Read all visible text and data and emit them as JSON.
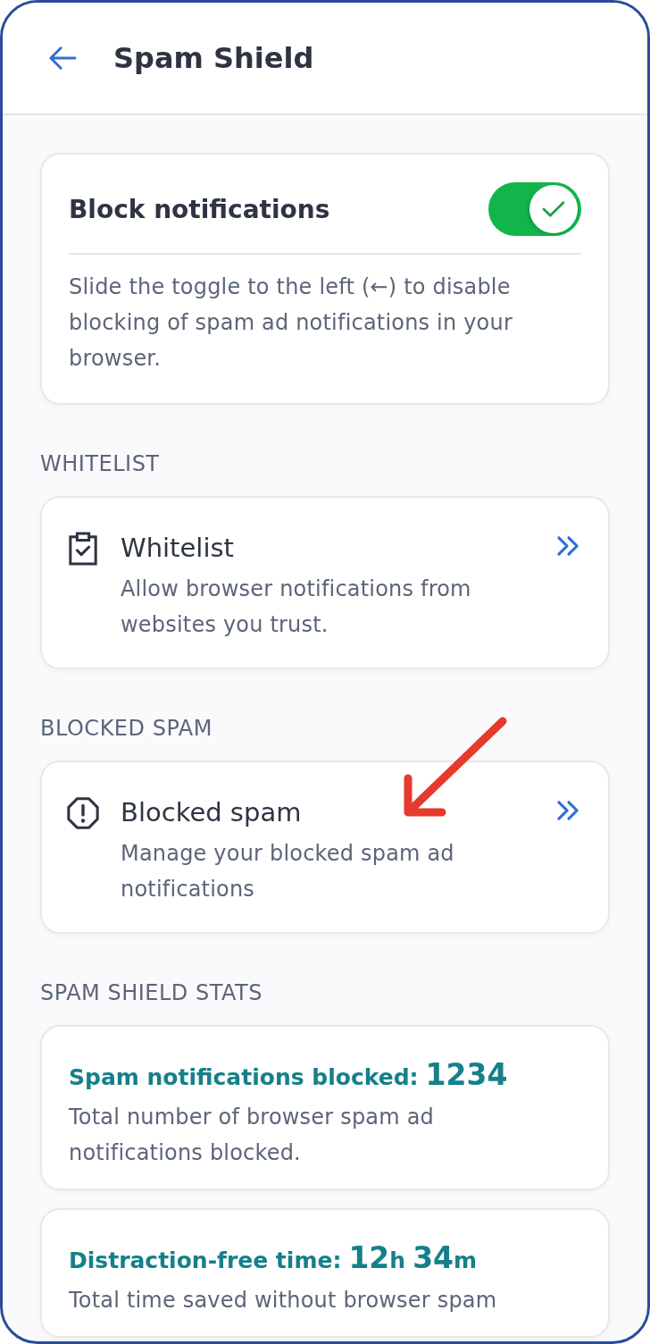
{
  "header": {
    "title": "Spam Shield"
  },
  "block_card": {
    "title": "Block notifications",
    "on": true,
    "description": "Slide the toggle to the left (←) to disable blocking of spam ad notifications in your browser."
  },
  "sections": [
    {
      "heading": "WHITELIST",
      "kind": "whitelist",
      "title": "Whitelist",
      "description": "Allow browser notifications from websites you trust."
    },
    {
      "heading": "BLOCKED SPAM",
      "kind": "blocked",
      "title": "Blocked spam",
      "description": "Manage your blocked spam ad notifications"
    }
  ],
  "stats": {
    "heading": "SPAM SHIELD STATS",
    "items": [
      {
        "label": "Spam notifications blocked:",
        "value": [
          {
            "text": "1234",
            "kind": "number"
          }
        ],
        "description": "Total number of browser spam ad notifications blocked."
      },
      {
        "label": "Distraction-free time:",
        "value": [
          {
            "text": "12",
            "kind": "number"
          },
          {
            "text": "h",
            "kind": "unit"
          },
          {
            "text": "34",
            "kind": "number"
          },
          {
            "text": "m",
            "kind": "unit"
          }
        ],
        "description": "Total time saved without browser spam"
      }
    ]
  }
}
